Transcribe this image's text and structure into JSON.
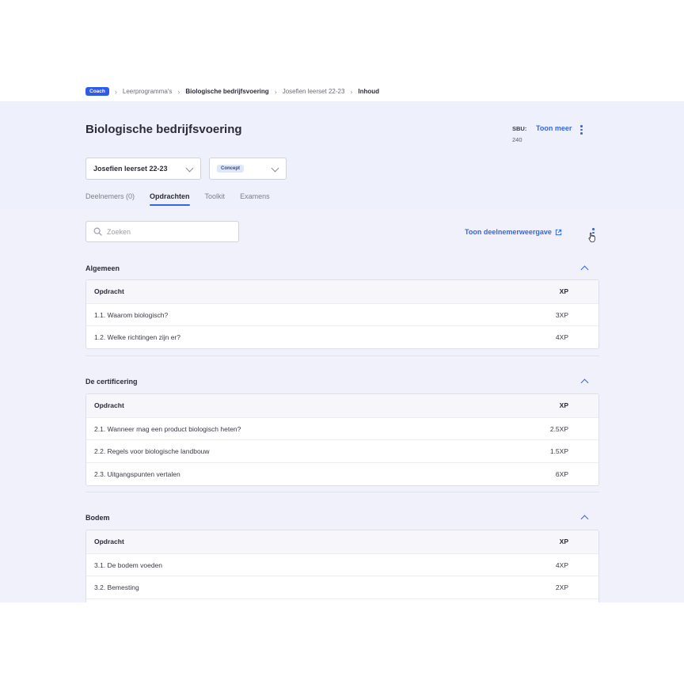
{
  "breadcrumb": {
    "role_badge": "Coach",
    "items": [
      "Leerprogramma's",
      "Biologische bedrijfsvoering",
      "Josefien leerset 22-23",
      "Inhoud"
    ]
  },
  "header": {
    "title": "Biologische bedrijfsvoering",
    "sbu_label": "SBU:",
    "sbu_value": "240",
    "toon_meer": "Toon meer"
  },
  "filters": {
    "set_select": "Josefien leerset 22-23",
    "status_select": "Concept"
  },
  "tabs": [
    {
      "label": "Deelnemers (0)",
      "active": false
    },
    {
      "label": "Opdrachten",
      "active": true
    },
    {
      "label": "Toolkit",
      "active": false
    },
    {
      "label": "Examens",
      "active": false
    }
  ],
  "search": {
    "placeholder": "Zoeken",
    "value": ""
  },
  "view_link": "Toon deelnemerweergave",
  "columns": {
    "task": "Opdracht",
    "xp": "XP"
  },
  "sections": [
    {
      "title": "Algemeen",
      "rows": [
        {
          "task": "1.1. Waarom biologisch?",
          "xp": "3XP"
        },
        {
          "task": "1.2. Welke richtingen zijn er?",
          "xp": "4XP"
        }
      ]
    },
    {
      "title": "De certificering",
      "rows": [
        {
          "task": "2.1. Wanneer mag een product biologisch heten?",
          "xp": "2.5XP"
        },
        {
          "task": "2.2. Regels voor biologische landbouw",
          "xp": "1.5XP"
        },
        {
          "task": "2.3. Uitgangspunten vertalen",
          "xp": "6XP"
        }
      ]
    },
    {
      "title": "Bodem",
      "rows": [
        {
          "task": "3.1. De bodem voeden",
          "xp": "4XP"
        },
        {
          "task": "3.2. Bemesting",
          "xp": "2XP"
        }
      ]
    }
  ],
  "colors": {
    "accent": "#3466e6",
    "coach_badge": "#2f5bea",
    "background": "#f0f1fb"
  }
}
